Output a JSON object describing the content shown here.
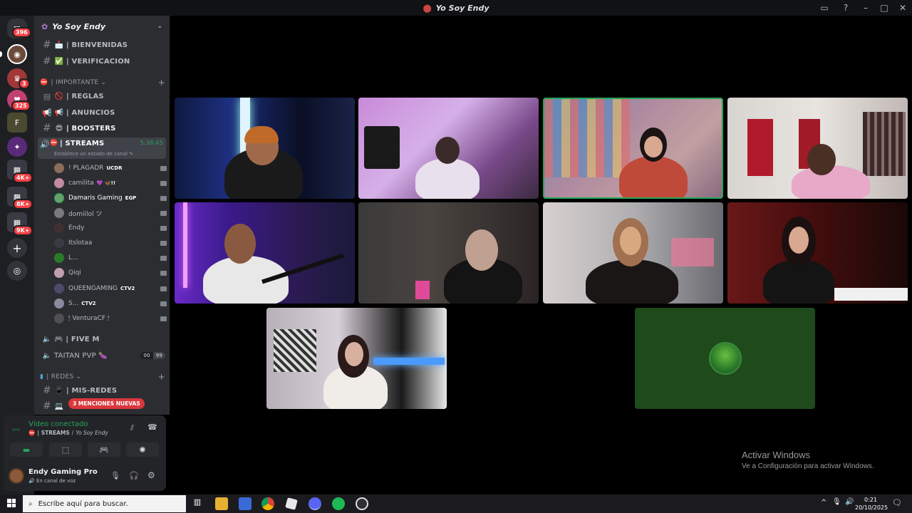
{
  "window": {
    "title": "Yo Soy Endy",
    "icons": [
      "inbox-icon",
      "help-icon",
      "minimize-icon",
      "maximize-icon",
      "close-icon"
    ]
  },
  "rail": {
    "badges": [
      "396",
      "3",
      "325",
      "4K+",
      "8K+",
      "9K+"
    ]
  },
  "server": {
    "name": "Yo Soy Endy"
  },
  "channels": [
    {
      "name": "| BIENVENIDAS",
      "emoji": "📩",
      "type": "text"
    },
    {
      "name": "| VERIFICACION",
      "emoji": "✅",
      "type": "text"
    }
  ],
  "categories": {
    "importante": "| IMPORTANTE",
    "redes": "| REDES"
  },
  "important_channels": [
    {
      "name": "| REGLAS",
      "emoji": "🚫"
    },
    {
      "name": "| ANUNCIOS",
      "emoji": "📢"
    },
    {
      "name": "| BOOSTERS",
      "emoji": "😍"
    }
  ],
  "active_voice": {
    "name": "| STREAMS",
    "timer": "5:38:45",
    "status": "Establece un estado de canal"
  },
  "voice_users": [
    {
      "name": "! PLAGADR",
      "tag": "UCDR",
      "color": "#8a6d5a"
    },
    {
      "name": "camilita",
      "tag": "💜 🦋!!",
      "color": "#c08aa0"
    },
    {
      "name": "Damaris Gaming",
      "tag": "EGP",
      "color": "#6aa06a"
    },
    {
      "name": "domiilol ツ",
      "tag": "",
      "color": "#7a7a7a"
    },
    {
      "name": "Endy",
      "tag": "",
      "color": "#403030"
    },
    {
      "name": "Itslotaa",
      "tag": "",
      "color": "#3a3a44"
    },
    {
      "name": "L...",
      "tag": "",
      "color": "#2a7a2a"
    },
    {
      "name": "Qiqi",
      "tag": "",
      "color": "#c0a0b0"
    },
    {
      "name": "QUEENGAMING",
      "tag": "CTV2",
      "color": "#4a4a6a"
    },
    {
      "name": "S...",
      "tag": "CTV2",
      "color": "#8a8aa0"
    },
    {
      "name": "🕯 VenturaCF 🕯",
      "tag": "",
      "color": "#505050"
    }
  ],
  "other_voice": [
    {
      "name": "🎮 | FIVE M"
    },
    {
      "name": "TAITAN PVP 🍆",
      "counts": [
        "00",
        "99"
      ]
    }
  ],
  "redes_channels": [
    {
      "name": "| MIS-REDES",
      "emoji": "📱"
    }
  ],
  "mentions_pill": "3 MENCIONES NUEVAS",
  "voice_panel": {
    "status": "Vídeo conectado",
    "channel": "| STREAMS",
    "server": "Yo Soy Endy"
  },
  "user_panel": {
    "name": "Endy Gaming Pro",
    "status": "En canal de voz"
  },
  "taskbar": {
    "search_placeholder": "Escribe aquí para buscar.",
    "time": "0:21",
    "date": "20/10/2025"
  },
  "watermark": {
    "title": "Activar Windows",
    "subtitle": "Ve a Configuración para activar Windows."
  },
  "colors": {
    "accent_green": "#23a559",
    "danger": "#f23f43",
    "tile_green": "#1e4a1c"
  }
}
